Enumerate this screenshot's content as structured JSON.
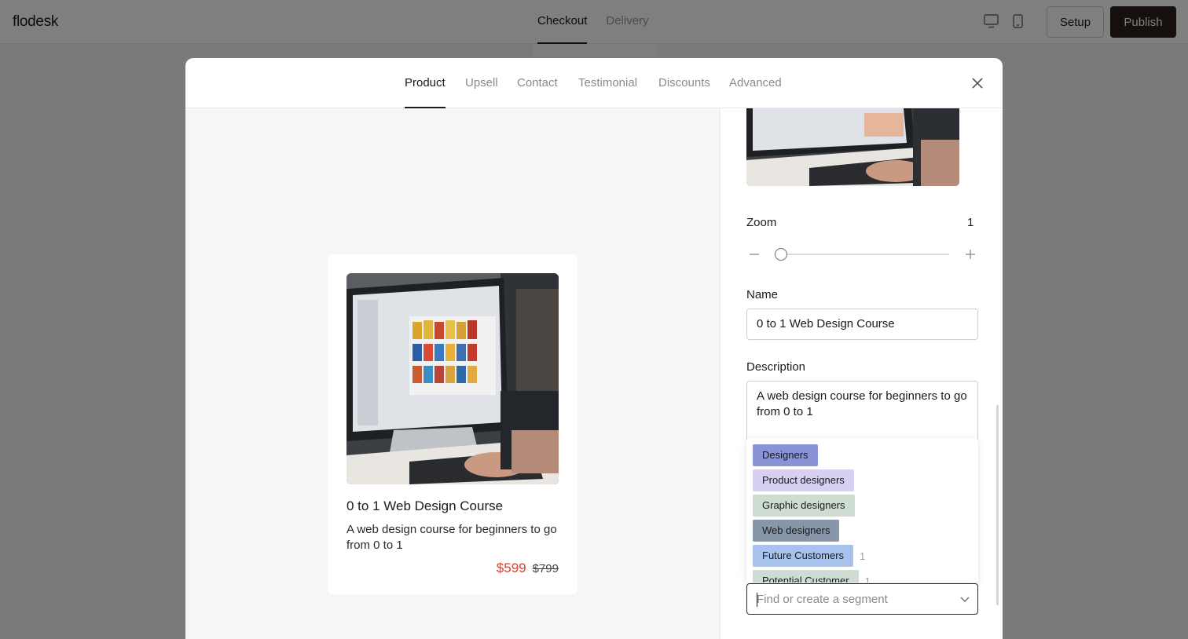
{
  "app": {
    "logo": "flodesk"
  },
  "top_tabs": [
    {
      "label": "Checkout",
      "active": true
    },
    {
      "label": "Delivery",
      "active": false
    }
  ],
  "toolbar": {
    "setup_label": "Setup",
    "publish_label": "Publish"
  },
  "modal": {
    "tabs": [
      {
        "label": "Product",
        "active": true
      },
      {
        "label": "Upsell",
        "active": false
      },
      {
        "label": "Contact",
        "active": false
      },
      {
        "label": "Testimonial",
        "active": false
      },
      {
        "label": "Discounts",
        "active": false
      },
      {
        "label": "Advanced",
        "active": false
      }
    ]
  },
  "product_card": {
    "title": "0 to 1 Web Design Course",
    "description": "A web design course for beginners to go from 0 to 1",
    "price_sale": "$599",
    "price_original": "$799"
  },
  "settings": {
    "zoom_label": "Zoom",
    "zoom_value": "1",
    "zoom_level_fraction": 0.0,
    "name_label": "Name",
    "name_value": "0 to 1 Web Design Course",
    "description_label": "Description",
    "description_value": "A web design course for beginners to go from 0 to 1",
    "segment_placeholder": "Find or create a segment"
  },
  "segments": [
    {
      "label": "Designers",
      "color": "#8a93d6",
      "count": ""
    },
    {
      "label": "Product designers",
      "color": "#d8d0f2",
      "count": ""
    },
    {
      "label": "Graphic designers",
      "color": "#cfdcd2",
      "count": ""
    },
    {
      "label": "Web designers",
      "color": "#8796a8",
      "count": ""
    },
    {
      "label": "Future Customers",
      "color": "#a8c2ee",
      "count": "1"
    },
    {
      "label": "Potential Customer",
      "color": "#cfdcd2",
      "count": "1"
    }
  ],
  "colors": {
    "publish_bg": "#2a1e1a",
    "sale_price": "#d0433b",
    "accent_text": "#1a1a1a"
  }
}
